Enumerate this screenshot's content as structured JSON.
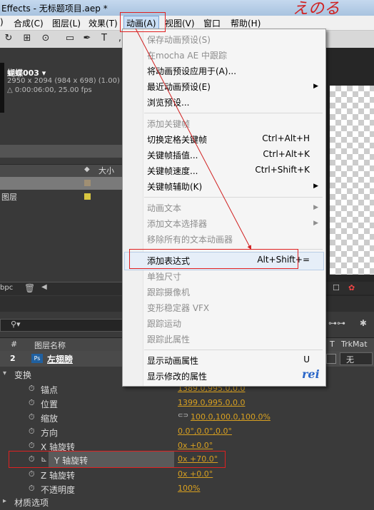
{
  "title_bar": {
    "text": "Effects - 无标题项目.aep *"
  },
  "menubar": {
    "items": [
      "合成(C)",
      "图层(L)",
      "效果(T)",
      "动画(A)",
      "视图(V)",
      "窗口",
      "帮助(H)"
    ],
    "active": "动画(A)"
  },
  "project": {
    "comp_name": "蝴蝶003 ▾",
    "comp_dims": "2950 x 2094  (984 x 698) (1.00)",
    "comp_duration": "△ 0:00:06:00, 25.00 fps",
    "col_size": "大小",
    "row_label": "图层",
    "bpc": "bpc"
  },
  "timeline": {
    "search_placeholder": "",
    "header_num": "#",
    "header_name": "图层名称",
    "header_t": "T",
    "header_trkmat": "TrkMat",
    "layer_num": "2",
    "layer_name": "左翅膀",
    "trkmat_value": "无",
    "group": "变换",
    "properties": [
      {
        "name": "锚点",
        "value": "1389.0,995.0,0.0"
      },
      {
        "name": "位置",
        "value": "1399.0,995.0,0.0"
      },
      {
        "name": "缩放",
        "value": "100.0,100.0,100.0%"
      },
      {
        "name": "方向",
        "value": "0.0°,0.0°,0.0°"
      },
      {
        "name": "X 轴旋转",
        "value": "0x +0.0°"
      },
      {
        "name": "Y 轴旋转",
        "value": "0x +70.0°"
      },
      {
        "name": "Z 轴旋转",
        "value": "0x +0.0°"
      },
      {
        "name": "不透明度",
        "value": "100%"
      }
    ],
    "material": "材质选项"
  },
  "anim_menu": {
    "items": [
      {
        "label": "保存动画预设(S)"
      },
      {
        "label": "在mocha AE 中跟踪"
      },
      {
        "label": "将动画预设应用于(A)..."
      },
      {
        "label": "最近动画预设(E)"
      },
      {
        "label": "浏览预设..."
      },
      {
        "label": "添加关键帧"
      },
      {
        "label": "切换定格关键帧",
        "shortcut": "Ctrl+Alt+H"
      },
      {
        "label": "关键帧插值...",
        "shortcut": "Ctrl+Alt+K"
      },
      {
        "label": "关键帧速度...",
        "shortcut": "Ctrl+Shift+K"
      },
      {
        "label": "关键帧辅助(K)"
      },
      {
        "label": "动画文本"
      },
      {
        "label": "添加文本选择器"
      },
      {
        "label": "移除所有的文本动画器"
      },
      {
        "label": "添加表达式",
        "shortcut": "Alt+Shift+="
      },
      {
        "label": "单独尺寸"
      },
      {
        "label": "跟踪摄像机"
      },
      {
        "label": "变形稳定器 VFX"
      },
      {
        "label": "跟踪运动"
      },
      {
        "label": "跟踪此属性"
      },
      {
        "label": "显示动画属性",
        "shortcut": "U"
      },
      {
        "label": "显示修改的属性"
      }
    ]
  },
  "watermark": "rei"
}
